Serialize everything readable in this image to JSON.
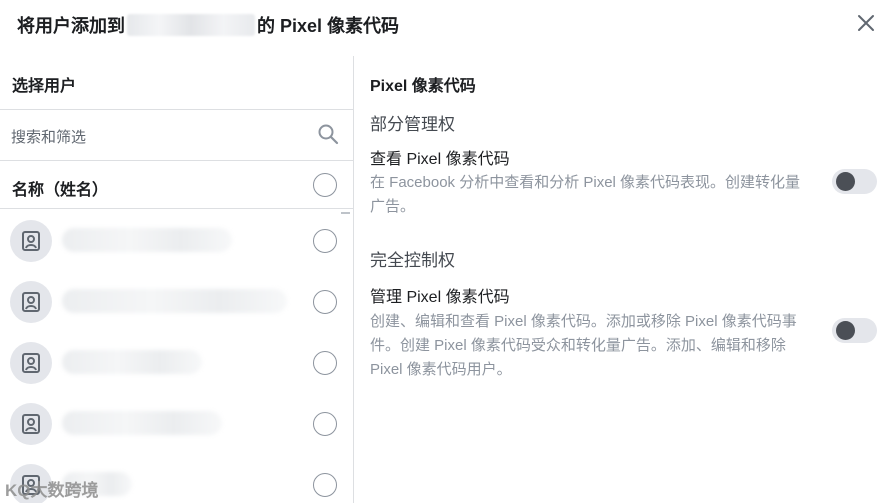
{
  "dialog": {
    "title_prefix": "将用户添加到",
    "title_suffix": "的 Pixel 像素代码"
  },
  "left_panel": {
    "title": "选择用户",
    "search_placeholder": "搜索和筛选",
    "column_label": "名称（姓名）",
    "users": [
      {
        "name": "",
        "selected": false
      },
      {
        "name": "",
        "selected": false
      },
      {
        "name": "",
        "selected": false
      },
      {
        "name": "",
        "selected": false
      },
      {
        "name": "",
        "selected": false
      }
    ]
  },
  "right_panel": {
    "title": "Pixel 像素代码",
    "partial_access": {
      "section_title": "部分管理权",
      "perm_title": "查看 Pixel 像素代码",
      "perm_desc": "在 Facebook 分析中查看和分析 Pixel 像素代码表现。创建转化量广告。",
      "enabled": false
    },
    "full_access": {
      "section_title": "完全控制权",
      "perm_title": "管理 Pixel 像素代码",
      "perm_desc": "创建、编辑和查看 Pixel 像素代码。添加或移除 Pixel 像素代码事件。创建 Pixel 像素代码受众和转化量广告。添加、编辑和移除 Pixel 像素代码用户。",
      "enabled": false
    }
  },
  "watermark": "KQ大数跨境",
  "icons": {
    "close": "close-icon",
    "search": "search-icon",
    "avatar": "user-avatar-icon"
  }
}
